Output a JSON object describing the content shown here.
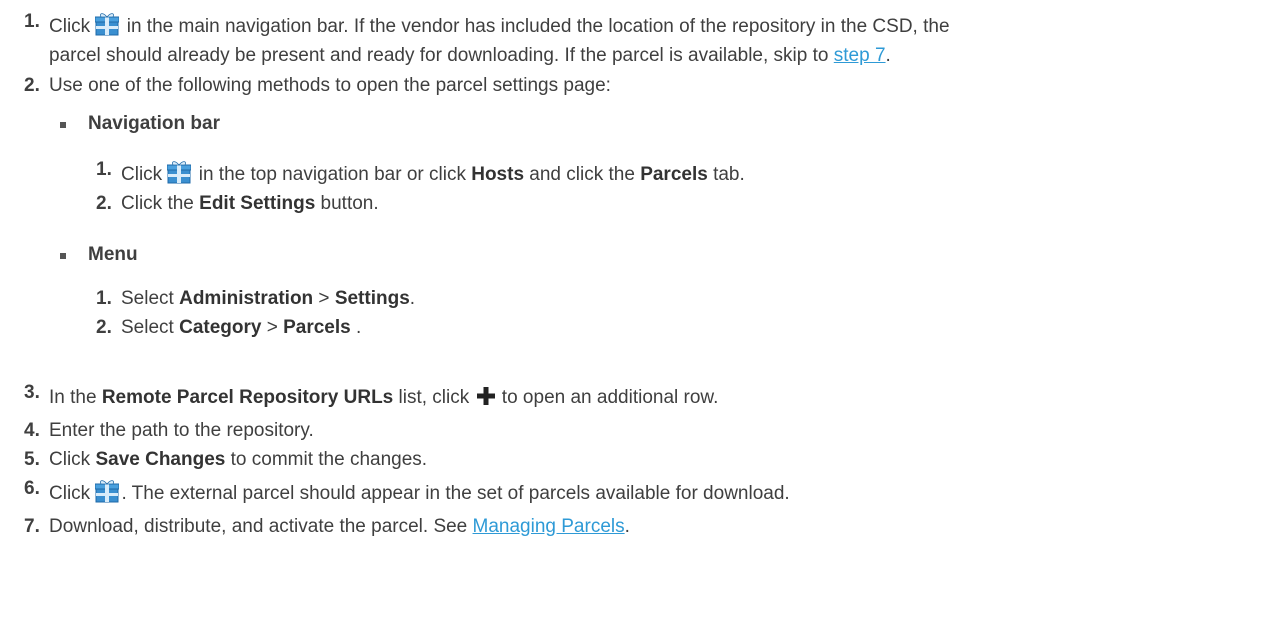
{
  "steps": {
    "s1": {
      "num": "1.",
      "pre": "Click",
      "post": " in the main navigation bar. If the vendor has included the location of the repository in the CSD, the",
      "line2_pre": "parcel should already be present and ready for downloading. If the parcel is available, skip to ",
      "link": "step 7",
      "line2_post": "."
    },
    "s2": {
      "num": "2.",
      "text": "Use one of the following methods to open the parcel settings page:",
      "nav_bar": {
        "label": "Navigation bar",
        "sub1_num": "1.",
        "sub1_pre": "Click",
        "sub1_mid": " in the top navigation bar or click ",
        "sub1_b1": "Hosts",
        "sub1_mid2": " and click the ",
        "sub1_b2": "Parcels",
        "sub1_post": " tab.",
        "sub2_num": "2.",
        "sub2_pre": "Click the ",
        "sub2_b": "Edit Settings",
        "sub2_post": " button."
      },
      "menu": {
        "label": "Menu",
        "sub1_num": "1.",
        "sub1_pre": "Select ",
        "sub1_b1": "Administration",
        "sub1_sep": " > ",
        "sub1_b2": "Settings",
        "sub1_post": ".",
        "sub2_num": "2.",
        "sub2_pre": "Select ",
        "sub2_b1": "Category",
        "sub2_sep": " > ",
        "sub2_b2": "Parcels",
        "sub2_post": " ."
      }
    },
    "s3": {
      "num": "3.",
      "pre": "In the ",
      "b": "Remote Parcel Repository URLs",
      "mid": " list, click ",
      "post": " to open an additional row."
    },
    "s4": {
      "num": "4.",
      "text": "Enter the path to the repository."
    },
    "s5": {
      "num": "5.",
      "pre": "Click ",
      "b": "Save Changes",
      "post": " to commit the changes."
    },
    "s6": {
      "num": "6.",
      "pre": "Click",
      "post": ". The external parcel should appear in the set of parcels available for download."
    },
    "s7": {
      "num": "7.",
      "pre": "Download, distribute, and activate the parcel. See ",
      "link": "Managing Parcels",
      "post": "."
    }
  },
  "icons": {
    "parcel": "parcel-gift-icon",
    "plus": "plus-icon"
  },
  "colors": {
    "text": "#3f3f3f",
    "link": "#2e9ad6",
    "icon_fill": "#3a8fd0"
  }
}
